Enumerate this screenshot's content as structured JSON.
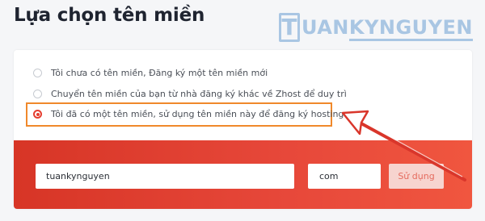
{
  "page": {
    "title": "Lựa chọn tên miền"
  },
  "watermark": {
    "letter": "T",
    "text_prefix": "UAN",
    "text_underlined": "KYNGUYEN"
  },
  "options": [
    {
      "label": "Tôi chưa có tên miền, Đăng ký một tên miền mới",
      "checked": false
    },
    {
      "label": "Chuyển tên miền của bạn từ nhà đăng ký khác về Zhost để duy trì",
      "checked": false
    },
    {
      "label": "Tôi đã có một tên miền, sử dụng tên miền này để đăng ký hosting.",
      "checked": true
    }
  ],
  "form": {
    "domain_value": "tuankynguyen",
    "tld_value": "com",
    "submit_label": "Sử dụng"
  },
  "colors": {
    "accent": "#e53e30",
    "highlight": "#f0892b",
    "band_start": "#d73526",
    "band_end": "#f0563f"
  }
}
